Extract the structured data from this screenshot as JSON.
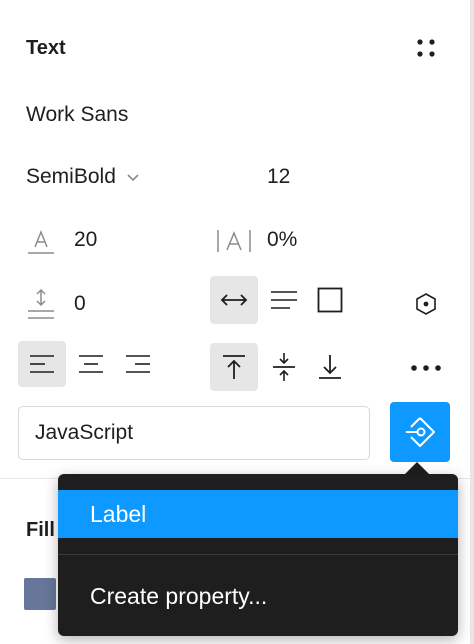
{
  "text_section": {
    "title": "Text",
    "font_family": "Work Sans",
    "font_weight": "SemiBold",
    "font_size": "12",
    "line_height": "20",
    "letter_spacing": "0%",
    "paragraph_spacing": "0"
  },
  "variable_field": {
    "value": "JavaScript"
  },
  "fill_section": {
    "title": "Fill",
    "swatch_color": "#667799"
  },
  "dropdown_menu": {
    "items": [
      {
        "label": "Label",
        "active": true
      },
      {
        "label": "Create property...",
        "active": false
      }
    ]
  },
  "colors": {
    "accent": "#0d99ff",
    "menu_bg": "#1e1e1e",
    "selected_bg": "#e6e6e6"
  },
  "icons": [
    "grid-styles-icon",
    "chevron-down-icon",
    "line-height-icon",
    "letter-spacing-icon",
    "paragraph-spacing-icon",
    "auto-width-icon",
    "auto-height-icon",
    "fixed-size-icon",
    "component-property-icon",
    "align-left-icon",
    "align-center-icon",
    "align-right-icon",
    "align-top-icon",
    "align-middle-icon",
    "align-bottom-icon",
    "more-options-icon",
    "apply-variable-icon"
  ]
}
